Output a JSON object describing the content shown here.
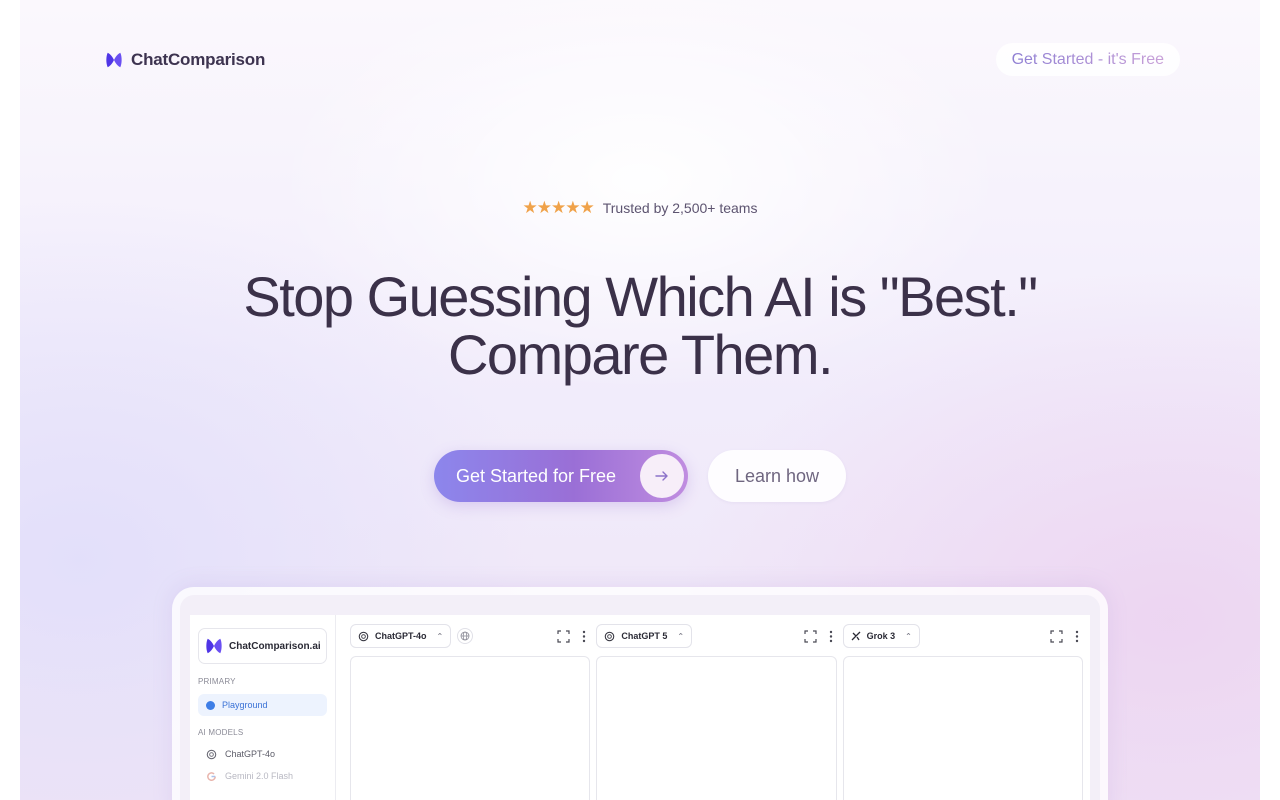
{
  "colors": {
    "accent": "#5b3df5",
    "headline": "#3b3149",
    "star": "#f0a24a",
    "playground_active": "#3a72d6"
  },
  "header": {
    "logo_text": "ChatComparison",
    "cta_label": "Get Started - it's Free"
  },
  "trust": {
    "stars": "★★★★★",
    "rating": 5,
    "text": "Trusted by 2,500+ teams"
  },
  "hero": {
    "headline_line1": "Stop Guessing Which AI is \"Best.\"",
    "headline_line2": "Compare Them."
  },
  "buttons": {
    "primary_label": "Get Started for Free",
    "primary_icon": "arrow-right-icon",
    "secondary_label": "Learn how"
  },
  "app_preview": {
    "brand": "ChatComparison.ai",
    "sidebar": {
      "primary_section": "PRIMARY",
      "active_item": "Playground",
      "models_section": "AI MODELS",
      "models": [
        {
          "label": "ChatGPT-4o",
          "icon": "openai-icon"
        },
        {
          "label": "Gemini 2.0 Flash",
          "icon": "google-icon"
        }
      ]
    },
    "panels": [
      {
        "model": "ChatGPT-4o",
        "icon": "openai-icon",
        "has_globe": true
      },
      {
        "model": "ChatGPT 5",
        "icon": "openai-icon",
        "has_globe": false
      },
      {
        "model": "Grok 3",
        "icon": "grok-icon",
        "has_globe": false
      }
    ]
  }
}
